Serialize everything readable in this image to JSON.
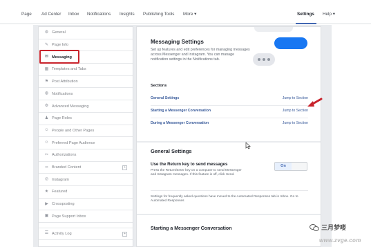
{
  "topnav": {
    "items": [
      "Page",
      "Ad Center",
      "Inbox",
      "Notifications",
      "Insights",
      "Publishing Tools",
      "More"
    ],
    "settings": "Settings",
    "help": "Help"
  },
  "sidebar": {
    "items": [
      {
        "label": "General",
        "icon": "gear-icon"
      },
      {
        "label": "Page Info",
        "icon": "pencil-icon"
      },
      {
        "label": "Messaging",
        "icon": "chat-icon"
      },
      {
        "label": "Templates and Tabs",
        "icon": "grid-icon"
      },
      {
        "label": "Post Attribution",
        "icon": "flag-icon"
      },
      {
        "label": "Notifications",
        "icon": "globe-icon"
      },
      {
        "label": "Advanced Messaging",
        "icon": "gear-icon"
      },
      {
        "label": "Page Roles",
        "icon": "person-icon"
      },
      {
        "label": "People and Other Pages",
        "icon": "people-icon"
      },
      {
        "label": "Preferred Page Audience",
        "icon": "people-icon"
      },
      {
        "label": "Authorizations",
        "icon": "wrench-icon"
      },
      {
        "label": "Branded Content",
        "icon": "handshake-icon"
      },
      {
        "label": "Instagram",
        "icon": "instagram-icon"
      },
      {
        "label": "Featured",
        "icon": "star-icon"
      },
      {
        "label": "Crossposting",
        "icon": "video-icon"
      },
      {
        "label": "Page Support Inbox",
        "icon": "inbox-icon"
      },
      {
        "label": "Activity Log",
        "icon": "list-icon"
      }
    ],
    "active_index": 2
  },
  "main": {
    "title": "Messaging Settings",
    "description": "Set up features and edit preferences for managing messages across Messenger and Instagram. You can manage notification settings in the Notifications tab.",
    "sections_label": "Sections",
    "sections": [
      {
        "name": "General Settings",
        "jump": "Jump to Section"
      },
      {
        "name": "Starting a Messenger Conversation",
        "jump": "Jump to Section"
      },
      {
        "name": "During a Messenger Conversation",
        "jump": "Jump to Section"
      }
    ],
    "general": {
      "title": "General Settings",
      "return_key_label": "Use the Return key to send messages",
      "return_key_desc": "Press the Return/Enter key on a computer to send Messenger and Instagram messages. If this feature is off, click Send.",
      "toggle_value": "On",
      "note": "Settings for frequently asked questions have moved to the Automated Responses tab in Inbox. Go to Automated Responses"
    },
    "starting_title": "Starting a Messenger Conversation"
  },
  "watermark": {
    "name": "三月梦喽",
    "url": "www.zvge.com"
  },
  "colors": {
    "accent": "#4267b2",
    "highlight": "#c8232c",
    "blue_button": "#1877f2"
  }
}
